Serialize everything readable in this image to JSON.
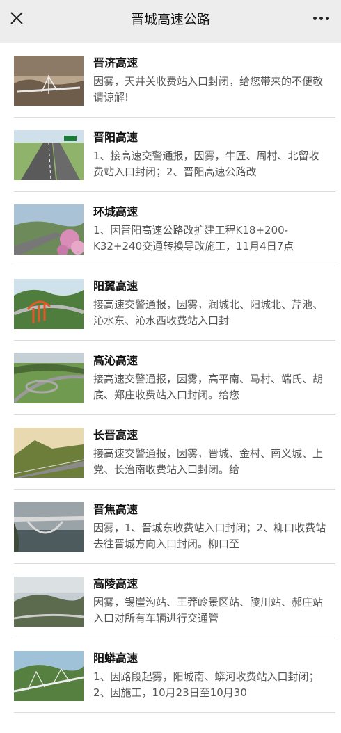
{
  "header": {
    "title": "晋城高速公路"
  },
  "items": [
    {
      "title": "晋济高速",
      "desc": "因雾，天井关收费站入口封闭，给您带来的不便敬请谅解!"
    },
    {
      "title": "晋阳高速",
      "desc": "1、接高速交警通报，因雾，牛匠、周村、北留收费站入口封闭；2、晋阳高速公路改"
    },
    {
      "title": "环城高速",
      "desc": "1、因晋阳高速公路改扩建工程K18+200-K32+240交通转换导改施工，11月4日7点"
    },
    {
      "title": "阳翼高速",
      "desc": "接高速交警通报，因雾，润城北、阳城北、芹池、沁水东、沁水西收费站入口封"
    },
    {
      "title": "高沁高速",
      "desc": "接高速交警通报，因雾，高平南、马村、端氏、胡底、郑庄收费站入口封闭。给您"
    },
    {
      "title": "长晋高速",
      "desc": "接高速交警通报，因雾，晋城、金村、南义城、上党、长治南收费站入口封闭。给"
    },
    {
      "title": "晋焦高速",
      "desc": "因雾，1、晋城东收费站入口封闭；2、柳口收费站去往晋城方向入口封闭。柳口至"
    },
    {
      "title": "高陵高速",
      "desc": "因雾，锡崖沟站、王莽岭景区站、陵川站、郝庄站入口对所有车辆进行交通管"
    },
    {
      "title": "阳蟒高速",
      "desc": "1、因路段起雾，阳城南、蟒河收费站入口封闭；2、因施工，10月23日至10月30"
    }
  ]
}
